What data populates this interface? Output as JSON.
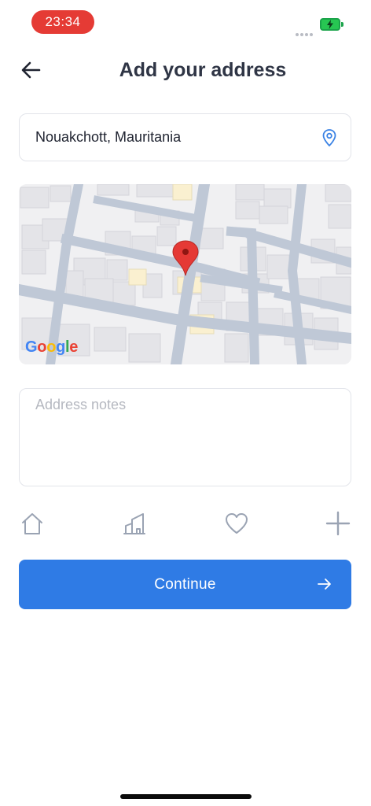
{
  "status_bar": {
    "time": "23:34"
  },
  "header": {
    "title": "Add your address"
  },
  "address": {
    "value": "Nouakchott, Mauritania"
  },
  "map": {
    "provider_label": "Google"
  },
  "notes": {
    "placeholder": "Address notes"
  },
  "labels": {
    "items": [
      "home-icon",
      "office-building-icon",
      "heart-icon",
      "plus-icon"
    ]
  },
  "actions": {
    "continue_label": "Continue"
  },
  "colors": {
    "accent": "#2f7be5",
    "status_pill": "#e53b35",
    "map_pin": "#e53935",
    "icon_gray": "#9aa3b3"
  }
}
